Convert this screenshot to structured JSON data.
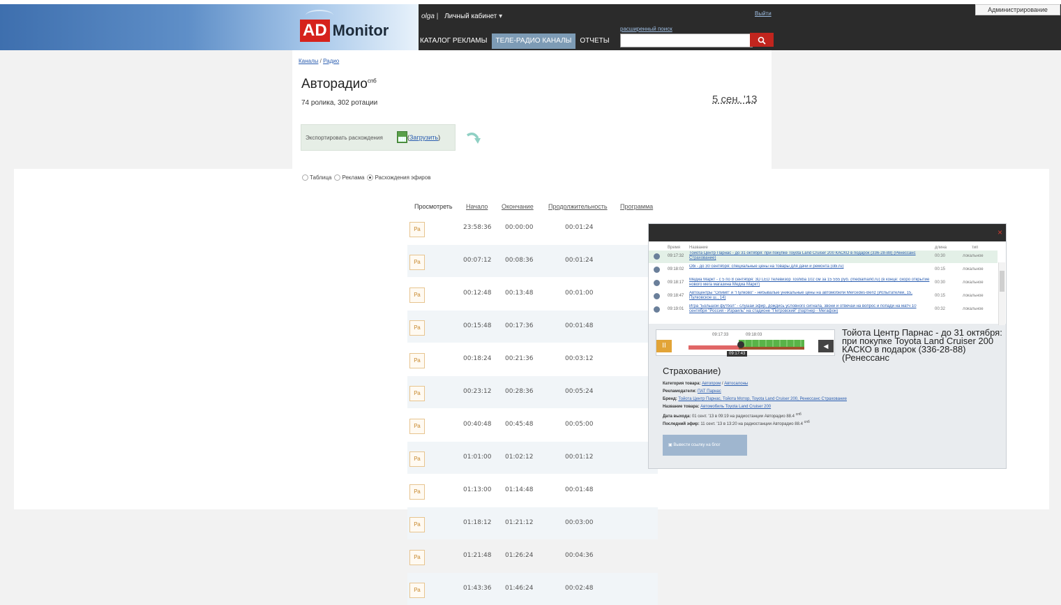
{
  "header": {
    "admin_label": "Администрирование",
    "logo_ad": "AD",
    "logo_monitor": "Monitor",
    "username": "olga",
    "cabinet_label": "Личный кабинет",
    "logout_label": "Выйти",
    "advanced_search_label": "расширенный поиск",
    "search_placeholder": "",
    "nav": [
      "КАТАЛОГ РЕКЛАМЫ",
      "ТЕЛЕ-РАДИО КАНАЛЫ",
      "ОТЧЕТЫ"
    ],
    "nav_active": 1
  },
  "breadcrumb": {
    "channels": "Каналы",
    "sep": " / ",
    "radio": "Радио"
  },
  "station": {
    "name": "Авторадио",
    "city": "спб",
    "stats": "74 ролика, 302 ротации",
    "date": "5 сен. '13"
  },
  "export": {
    "label": "Экспортировать расхождения",
    "link": "Загрузить"
  },
  "view_modes": {
    "table": "Таблица",
    "ads": "Реклама",
    "diff": "Расхождения эфиров",
    "selected": "diff"
  },
  "table": {
    "headers": [
      "Просмотреть",
      "Начало",
      "Окончание",
      "Продолжительность",
      "Программа"
    ],
    "play_label": "Ра",
    "rows": [
      {
        "start": "23:58:36",
        "end": "00:00:00",
        "dur": "00:01:24"
      },
      {
        "start": "00:07:12",
        "end": "00:08:36",
        "dur": "00:01:24"
      },
      {
        "start": "00:12:48",
        "end": "00:13:48",
        "dur": "00:01:00"
      },
      {
        "start": "00:15:48",
        "end": "00:17:36",
        "dur": "00:01:48"
      },
      {
        "start": "00:18:24",
        "end": "00:21:36",
        "dur": "00:03:12"
      },
      {
        "start": "00:23:12",
        "end": "00:28:36",
        "dur": "00:05:24"
      },
      {
        "start": "00:40:48",
        "end": "00:45:48",
        "dur": "00:05:00"
      },
      {
        "start": "01:01:00",
        "end": "01:02:12",
        "dur": "00:01:12"
      },
      {
        "start": "01:13:00",
        "end": "01:14:48",
        "dur": "00:01:48"
      },
      {
        "start": "01:18:12",
        "end": "01:21:12",
        "dur": "00:03:00"
      },
      {
        "start": "01:21:48",
        "end": "01:26:24",
        "dur": "00:04:36"
      },
      {
        "start": "01:43:36",
        "end": "01:46:24",
        "dur": "00:02:48"
      }
    ]
  },
  "popup": {
    "close_label": "×",
    "list_headers": {
      "time": "Время",
      "name": "Название",
      "length": "длина",
      "type": "тип"
    },
    "items": [
      {
        "time": "09:17:32",
        "name": "Тойота Центр Парнас - до 31 октября: при покупке Toyota Land Cruiser 200 КАСКО в подарок (336-28-88) (Ренессанс Страхование)",
        "length": "00:30",
        "type": "локальное",
        "selected": true
      },
      {
        "time": "09:18:02",
        "name": "Obi - до 30 сентября: специальные цены на товары для дачи и ремонта (obi.ru)",
        "length": "00:15",
        "type": "локальное",
        "selected": false
      },
      {
        "time": "09:18:17",
        "name": "Медиа Маркт - с 5 по 8 сентября: 3D LED телевизор Toshiba 102 см за 15 555 руб. (mediamarkt.ru) (в конце: скоро открытие нового мега магазина Медиа Маркт)",
        "length": "00:30",
        "type": "локальное",
        "selected": false
      },
      {
        "time": "09:18:47",
        "name": "Автоцентры \"Олимп\" и \"Пулково\" - небывалые уникальные цены на автомобили Mercedes-Benz (Испытателей, 15, Пулковское ш., 14)",
        "length": "00:15",
        "type": "локальное",
        "selected": false
      },
      {
        "time": "09:19:01",
        "name": "Игра \"Большой футбол\" - слушай эфир, дождись условного сигнала, звони и отвечай на вопрос и попади на матч 10 сентября \"Россия - Израиль\" на стадионе \"Петровский\" (партнер - Мегафон)",
        "length": "00:32",
        "type": "локальное",
        "selected": false
      }
    ],
    "timeline": {
      "label_a": "09:17:33",
      "label_b": "09:18:03",
      "current": "09:17:43",
      "pause_icon": "II",
      "volume_icon": "◀"
    },
    "title": "Тойота Центр Парнас - до 31 октября: при покупке Toyota Land Cruiser 200 КАСКО в подарок (336-28-88) (Ренессанс",
    "title_cont": "Страхование)",
    "meta": {
      "category_label": "Категория товара:",
      "category_1": "Автопром",
      "category_2": "Автосалоны",
      "advertisers_label": "Рекламодатели:",
      "advertiser": "ПАТ Парнас",
      "brands_label": "Бренд:",
      "brands": "Тойота Центр Парнас, Тойота Мотор, Toyota Land Cruiser 200, Ренессанс Страхование",
      "product_label": "Название товара:",
      "product": "Автомобиль Toyota Land Cruiser 200",
      "release_label": "Дата выхода:",
      "release": "01 сент. '13 в 09:19 на радиостанции Авторадио 88.4",
      "last_label": "Последний эфир:",
      "last": "11 сент. '13 в 13:20 на радиостанции Авторадио 88.4",
      "sup": "спб"
    },
    "blog_button": "Вывести ссылку на блог"
  }
}
